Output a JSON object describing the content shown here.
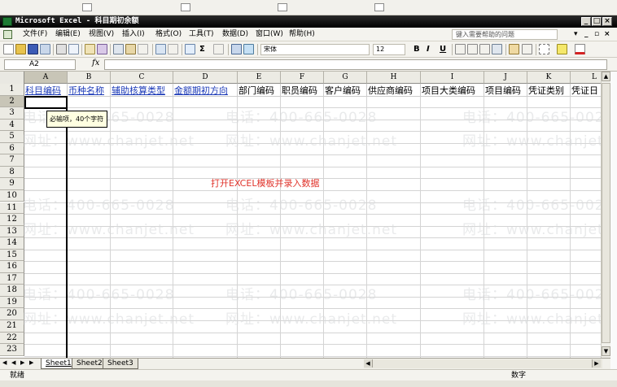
{
  "window": {
    "title": "Microsoft Excel - 科目期初余额"
  },
  "menu": {
    "items": [
      "文件(F)",
      "编辑(E)",
      "视图(V)",
      "插入(I)",
      "格式(O)",
      "工具(T)",
      "数据(D)",
      "窗口(W)",
      "帮助(H)"
    ],
    "help_placeholder": "键入需要帮助的问题"
  },
  "toolbar": {
    "font_name": "宋体",
    "font_size": "12",
    "bold": "B",
    "italic": "I",
    "underline": "U"
  },
  "formula_bar": {
    "name_box": "A2",
    "fx": "fx",
    "formula": ""
  },
  "sheet": {
    "columns": [
      "A",
      "B",
      "C",
      "D",
      "E",
      "F",
      "G",
      "H",
      "I",
      "J",
      "K",
      "L"
    ],
    "rows": [
      "1",
      "2",
      "3",
      "4",
      "5",
      "6",
      "7",
      "8",
      "9",
      "10",
      "11",
      "12",
      "13",
      "14",
      "15",
      "16",
      "17",
      "18",
      "19",
      "20",
      "21",
      "22",
      "23"
    ],
    "header_row": [
      "科目编码",
      "币种名称",
      "辅助核算类型",
      "金额期初方向",
      "部门编码",
      "职员编码",
      "客户编码",
      "供应商编码",
      "项目大类编码",
      "项目编码",
      "凭证类别",
      "凭证日"
    ],
    "tooltip": "必输项，40个字符",
    "center_note": "打开EXCEL模板并录入数据"
  },
  "watermark": {
    "phone": "电话：400-665-0028",
    "site": "网址：www.chanjet.net",
    "site_fragment": "www.chanjet"
  },
  "tabs": [
    "Sheet1",
    "Sheet2",
    "Sheet3"
  ],
  "status": {
    "ready": "就绪",
    "mode": "数字"
  },
  "colors": {
    "header_link": "#1d3bb8",
    "note_red": "#e0332b",
    "title_bg": "#000000"
  }
}
